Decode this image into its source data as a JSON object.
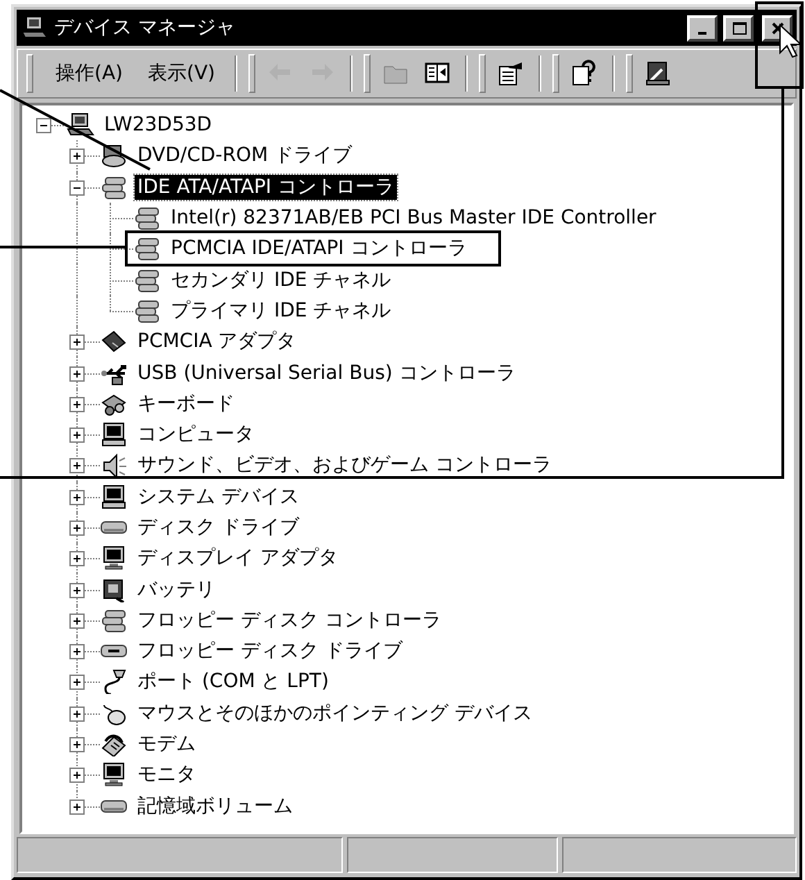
{
  "window": {
    "title": "デバイス マネージャ",
    "buttons": [
      {
        "kind": "minimize"
      },
      {
        "kind": "maximize"
      },
      {
        "kind": "close"
      }
    ]
  },
  "toolbar": {
    "menus": [
      {
        "label": "操作(A)"
      },
      {
        "label": "表示(V)"
      }
    ],
    "button_groups": [
      [
        {
          "kind": "back",
          "disabled": true
        },
        {
          "kind": "forward",
          "disabled": true
        }
      ],
      [
        {
          "kind": "folder",
          "disabled": true
        },
        {
          "kind": "panel",
          "disabled": false
        }
      ],
      [
        {
          "kind": "properties",
          "disabled": false
        }
      ],
      [
        {
          "kind": "help",
          "disabled": false
        }
      ],
      [
        {
          "kind": "scan",
          "disabled": false
        }
      ]
    ]
  },
  "tree": {
    "root": {
      "label": "LW23D53D",
      "kind": "computer",
      "expanded": true,
      "selected": false,
      "children": [
        {
          "label": "DVD/CD-ROM ドライブ",
          "kind": "cdrom",
          "expanded": false,
          "selected": false
        },
        {
          "label": "IDE ATA/ATAPI コントローラ",
          "kind": "controller",
          "expanded": true,
          "selected": true,
          "children": [
            {
              "label": "Intel(r) 82371AB/EB PCI Bus Master IDE Controller",
              "kind": "controller",
              "selected": false
            },
            {
              "label": "PCMCIA IDE/ATAPI コントローラ",
              "kind": "controller",
              "selected": false
            },
            {
              "label": "セカンダリ IDE チャネル",
              "kind": "controller",
              "selected": false
            },
            {
              "label": "プライマリ IDE チャネル",
              "kind": "controller",
              "selected": false
            }
          ]
        },
        {
          "label": "PCMCIA アダプタ",
          "kind": "card",
          "expanded": false,
          "selected": false
        },
        {
          "label": "USB (Universal Serial Bus) コントローラ",
          "kind": "usb",
          "expanded": false,
          "selected": false
        },
        {
          "label": "キーボード",
          "kind": "keyboard",
          "expanded": false,
          "selected": false
        },
        {
          "label": "コンピュータ",
          "kind": "pc",
          "expanded": false,
          "selected": false
        },
        {
          "label": "サウンド、ビデオ、およびゲーム コントローラ",
          "kind": "sound",
          "expanded": false,
          "selected": false
        },
        {
          "label": "システム デバイス",
          "kind": "pc",
          "expanded": false,
          "selected": false
        },
        {
          "label": "ディスク ドライブ",
          "kind": "disk",
          "expanded": false,
          "selected": false
        },
        {
          "label": "ディスプレイ アダプタ",
          "kind": "display",
          "expanded": false,
          "selected": false
        },
        {
          "label": "バッテリ",
          "kind": "battery",
          "expanded": false,
          "selected": false
        },
        {
          "label": "フロッピー ディスク コントローラ",
          "kind": "controller",
          "expanded": false,
          "selected": false
        },
        {
          "label": "フロッピー ディスク ドライブ",
          "kind": "floppy",
          "expanded": false,
          "selected": false
        },
        {
          "label": "ポート (COM と LPT)",
          "kind": "port",
          "expanded": false,
          "selected": false
        },
        {
          "label": "マウスとそのほかのポインティング デバイス",
          "kind": "mouse",
          "expanded": false,
          "selected": false
        },
        {
          "label": "モデム",
          "kind": "modem",
          "expanded": false,
          "selected": false
        },
        {
          "label": "モニタ",
          "kind": "display",
          "expanded": false,
          "selected": false
        },
        {
          "label": "記憶域ボリューム",
          "kind": "disk",
          "expanded": false,
          "selected": false
        }
      ]
    }
  }
}
